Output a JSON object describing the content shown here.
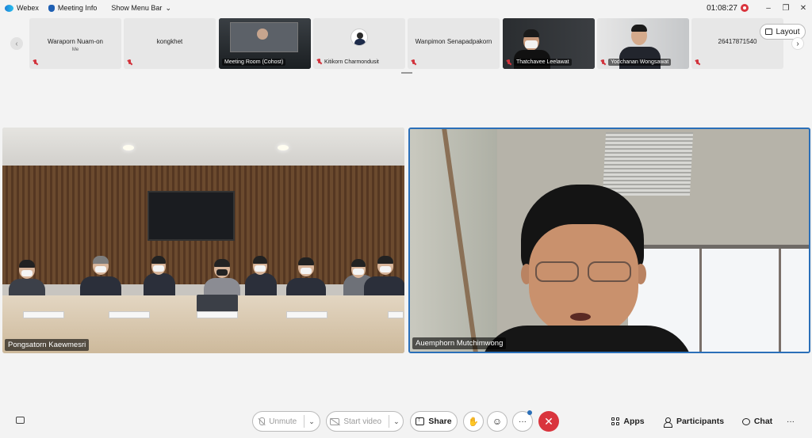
{
  "titlebar": {
    "app_name": "Webex",
    "meeting_info": "Meeting Info",
    "menu_toggle": "Show Menu Bar",
    "timer": "01:08:27"
  },
  "thumbnails": [
    {
      "name": "Waraporn Nuam-on",
      "sub": "Me",
      "muted": true,
      "video": false
    },
    {
      "name": "kongkhet",
      "muted": true,
      "video": false
    },
    {
      "name": "Meeting Room (Cohost)",
      "muted": false,
      "video": true
    },
    {
      "name": "Kitikorn Charmondusit",
      "muted": true,
      "video": false,
      "avatar": true
    },
    {
      "name": "Wanpimon Senapadpakorn",
      "muted": true,
      "video": false
    },
    {
      "name": "Thatchavee Leelawat",
      "muted": true,
      "video": true
    },
    {
      "name": "Yodchanan Wongsawat",
      "muted": true,
      "video": true
    },
    {
      "name": "26417871540",
      "muted": true,
      "video": false
    }
  ],
  "layout_button": "Layout",
  "main": {
    "left_name": "Pongsatorn Kaewmesri",
    "right_name": "Auemphorn Mutchimwong"
  },
  "controls": {
    "unmute": "Unmute",
    "start_video": "Start video",
    "share": "Share",
    "more": "···",
    "leave": "✕",
    "apps": "Apps",
    "participants": "Participants",
    "chat": "Chat",
    "overflow": "···"
  },
  "colors": {
    "accent": "#2a6fb8",
    "leave_red": "#d9343d",
    "muted_red": "#d2343d"
  }
}
